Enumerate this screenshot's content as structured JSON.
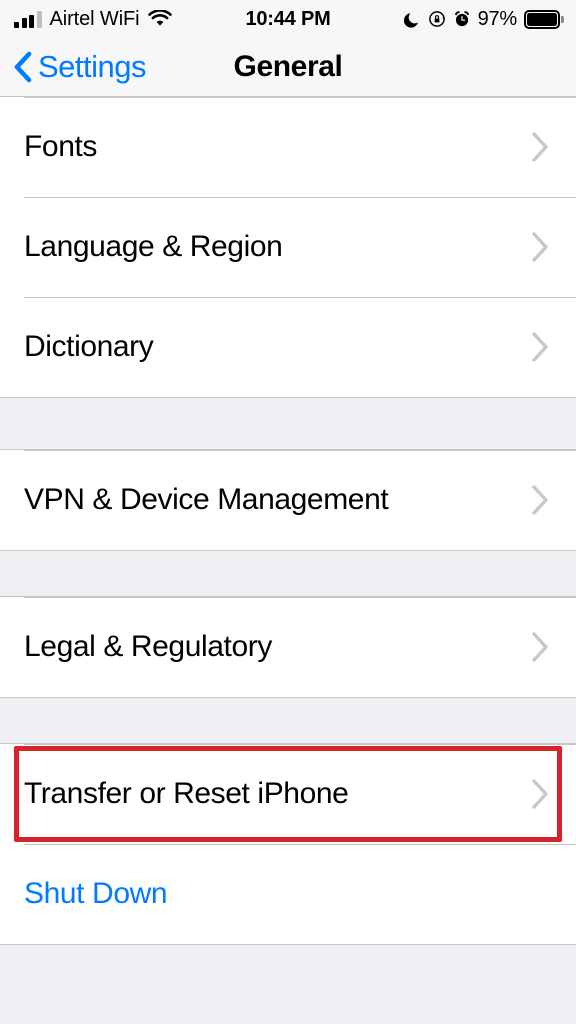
{
  "status_bar": {
    "carrier": "Airtel WiFi",
    "signal_icon": "cellular-signal-icon",
    "signal_bars_filled": 3,
    "signal_bars_total": 4,
    "wifi_icon": "wifi-icon",
    "time": "10:44 PM",
    "do_not_disturb_icon": "moon-icon",
    "rotation_lock_icon": "rotation-lock-icon",
    "alarm_icon": "alarm-clock-icon",
    "battery_percent": "97%",
    "battery_icon": "battery-full-icon"
  },
  "nav": {
    "back_label": "Settings",
    "back_icon": "chevron-left-icon",
    "title": "General"
  },
  "colors": {
    "accent_blue": "#007AFF",
    "highlight_red": "#D6242C",
    "group_background": "#EFEFF4",
    "row_background": "#FFFFFF",
    "separator": "#C6C6C8",
    "chevron": "#C7C7CC"
  },
  "sections": [
    {
      "rows": [
        {
          "label": "Fonts",
          "accessory": "chevron-right-icon",
          "style": "default",
          "highlighted": false
        },
        {
          "label": "Language & Region",
          "accessory": "chevron-right-icon",
          "style": "default",
          "highlighted": false
        },
        {
          "label": "Dictionary",
          "accessory": "chevron-right-icon",
          "style": "default",
          "highlighted": false
        }
      ]
    },
    {
      "rows": [
        {
          "label": "VPN & Device Management",
          "accessory": "chevron-right-icon",
          "style": "default",
          "highlighted": false
        }
      ]
    },
    {
      "rows": [
        {
          "label": "Legal & Regulatory",
          "accessory": "chevron-right-icon",
          "style": "default",
          "highlighted": false
        }
      ]
    },
    {
      "rows": [
        {
          "label": "Transfer or Reset iPhone",
          "accessory": "chevron-right-icon",
          "style": "default",
          "highlighted": true
        },
        {
          "label": "Shut Down",
          "accessory": "none",
          "style": "blue",
          "highlighted": false
        }
      ]
    }
  ]
}
